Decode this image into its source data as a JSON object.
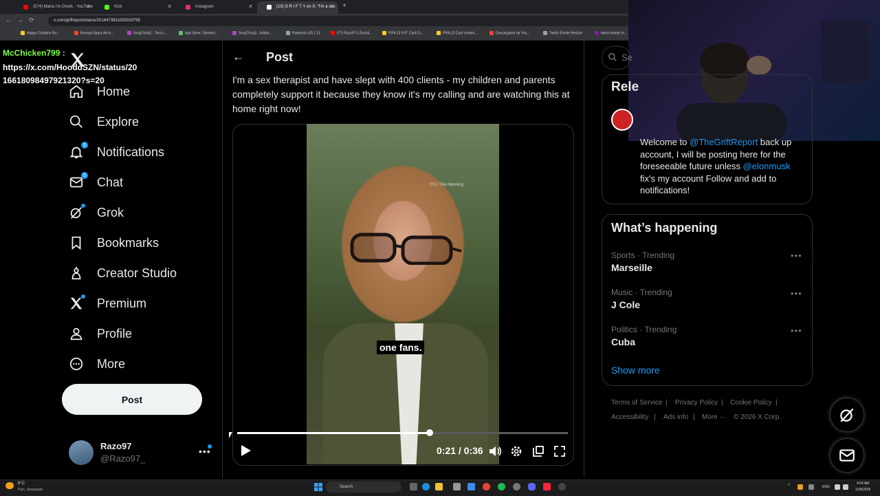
{
  "browser": {
    "tabs": [
      {
        "label": "(574) María I'm Drunk - YouTube",
        "color": "#ff0000"
      },
      {
        "label": "Kick",
        "color": "#53fc18"
      },
      {
        "label": "Instagram",
        "color": "#e1306c"
      },
      {
        "label": "(10) G R I F T Y on X: \"I'm a sex",
        "color": "#ffffff"
      }
    ],
    "url": "x.com/griftreport/status/2016473831083319795",
    "bookmarks": [
      "Happy Cristiano Ro...",
      "Burrego figura de to...",
      "SongTrivia2 - Test y...",
      "App Store / Streami...",
      "SongTrivia2 - Adivin...",
      "Paletools v25.1.11",
      "(77) Razo97's Zest-A...",
      "FIFA 23 FUT Card Cr...",
      "FIFA 23 Card creator...",
      "Descargador de You...",
      "Twitch Emote Resizer",
      "twitch emote re..."
    ]
  },
  "stream_chat": {
    "user": "McChicken799 :",
    "line1": "https://x.com/HooddSZN/status/20",
    "line2": "16618098497921320?s=20"
  },
  "nav": {
    "items": [
      {
        "label": "Home",
        "icon": "home-icon"
      },
      {
        "label": "Explore",
        "icon": "search-icon"
      },
      {
        "label": "Notifications",
        "icon": "bell-icon",
        "badge": "5"
      },
      {
        "label": "Chat",
        "icon": "mail-icon",
        "badge": "5"
      },
      {
        "label": "Grok",
        "icon": "grok-icon"
      },
      {
        "label": "Bookmarks",
        "icon": "bookmark-icon"
      },
      {
        "label": "Creator Studio",
        "icon": "creator-icon"
      },
      {
        "label": "Premium",
        "icon": "x-icon"
      },
      {
        "label": "Profile",
        "icon": "person-icon"
      },
      {
        "label": "More",
        "icon": "more-circle-icon"
      }
    ],
    "post_button": "Post",
    "account": {
      "name": "Razo97",
      "handle": "@Razo97_"
    }
  },
  "post": {
    "header": "Post",
    "text": "I'm a sex therapist and have slept with 400 clients - my children and parents completely support it because they know it's my calling and are watching this at home right now!",
    "video": {
      "watermark": "ITV / This Morning",
      "caption": "one fans.",
      "time": "0:21 / 0:36",
      "progress": 0.583
    }
  },
  "right": {
    "search_placeholder": "Se",
    "relevant": {
      "heading": "Rele",
      "bio_1": "Welcome to ",
      "mention_1": "@TheGriftReport",
      "bio_2": " back up account, I will be posting here for the foreseeable future unless ",
      "mention_2": "@elonmusk",
      "bio_3": " fix's my account Follow and add to notifications!"
    },
    "whats_happening": {
      "title": "What’s happening",
      "trends": [
        {
          "meta": "Sports · Trending",
          "name": "Marseille"
        },
        {
          "meta": "Music · Trending",
          "name": "J Cole"
        },
        {
          "meta": "Politics · Trending",
          "name": "Cuba"
        }
      ],
      "show_more": "Show more"
    },
    "footer": {
      "terms": "Terms of Service",
      "privacy": "Privacy Policy",
      "cookie": "Cookie Policy",
      "accessibility": "Accessibility",
      "ads": "Ads info",
      "more": "More ···",
      "copyright": "© 2026 X Corp."
    }
  },
  "taskbar": {
    "weather_temp": "8°C",
    "weather_desc": "Parc. despejado",
    "search": "Search",
    "lang": "ENG",
    "time": "4:04 AM",
    "date": "1/28/2026"
  }
}
